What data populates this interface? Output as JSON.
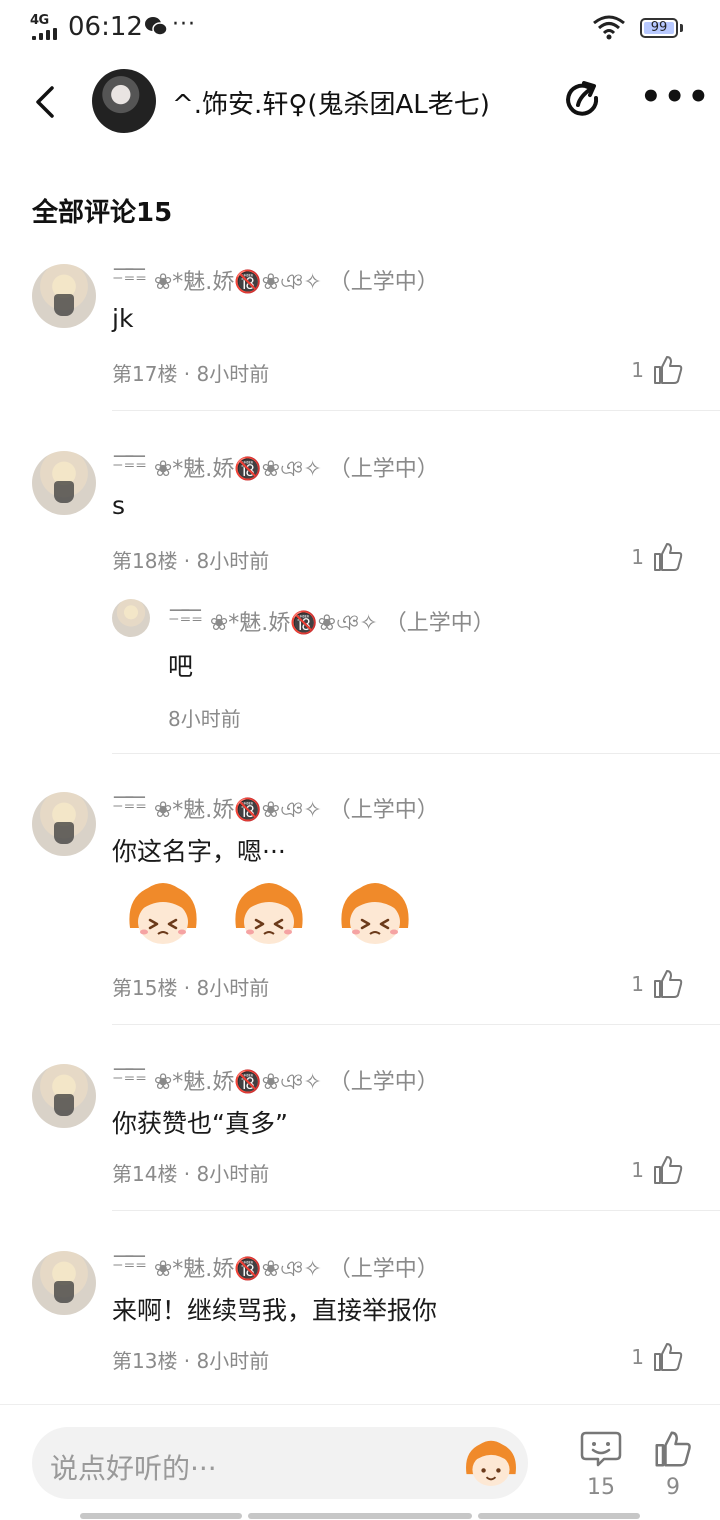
{
  "status_bar": {
    "network": "4G",
    "time": "06:12",
    "more": "···",
    "battery": "99"
  },
  "header": {
    "title": "^.饰安.轩♀(鬼杀团AL老七)"
  },
  "section": {
    "title": "全部评论15"
  },
  "comments": [
    {
      "name": "⁻͞⁼͞⁼ ❀*魅.娇🔞❀ঞ✧ （上学中）",
      "text": "jk",
      "meta": "第17楼 · 8小时前",
      "likes": "1"
    },
    {
      "name": "⁻͞⁼͞⁼ ❀*魅.娇🔞❀ঞ✧ （上学中）",
      "text": "s",
      "meta": "第18楼 · 8小时前",
      "likes": "1",
      "reply": {
        "name": "⁻͞⁼͞⁼ ❀*魅.娇🔞❀ঞ✧ （上学中）",
        "text": "吧",
        "meta": "8小时前"
      }
    },
    {
      "name": "⁻͞⁼͞⁼ ❀*魅.娇🔞❀ঞ✧ （上学中）",
      "text": "你这名字，嗯···",
      "meta": "第15楼 · 8小时前",
      "likes": "1"
    },
    {
      "name": "⁻͞⁼͞⁼ ❀*魅.娇🔞❀ঞ✧ （上学中）",
      "text": "你获赞也“真多”",
      "meta": "第14楼 · 8小时前",
      "likes": "1"
    },
    {
      "name": "⁻͞⁼͞⁼ ❀*魅.娇🔞❀ঞ✧ （上学中）",
      "text": "来啊！继续骂我，直接举报你",
      "meta": "第13楼 · 8小时前",
      "likes": "1"
    }
  ],
  "bottom_bar": {
    "placeholder": "说点好听的···",
    "comment_count": "15",
    "like_count": "9"
  },
  "icons": [
    "signal-icon",
    "wechat-icon",
    "wifi-icon",
    "battery-icon",
    "back-icon",
    "share-icon",
    "more-icon",
    "thumbs-up-icon",
    "comment-icon",
    "emoji-sticker-icon"
  ],
  "colors": {
    "text": "#1a1a1a",
    "secondary": "#8a8a8a",
    "input_bg": "#f2f2f2",
    "emoji_orange": "#f08a2a"
  }
}
